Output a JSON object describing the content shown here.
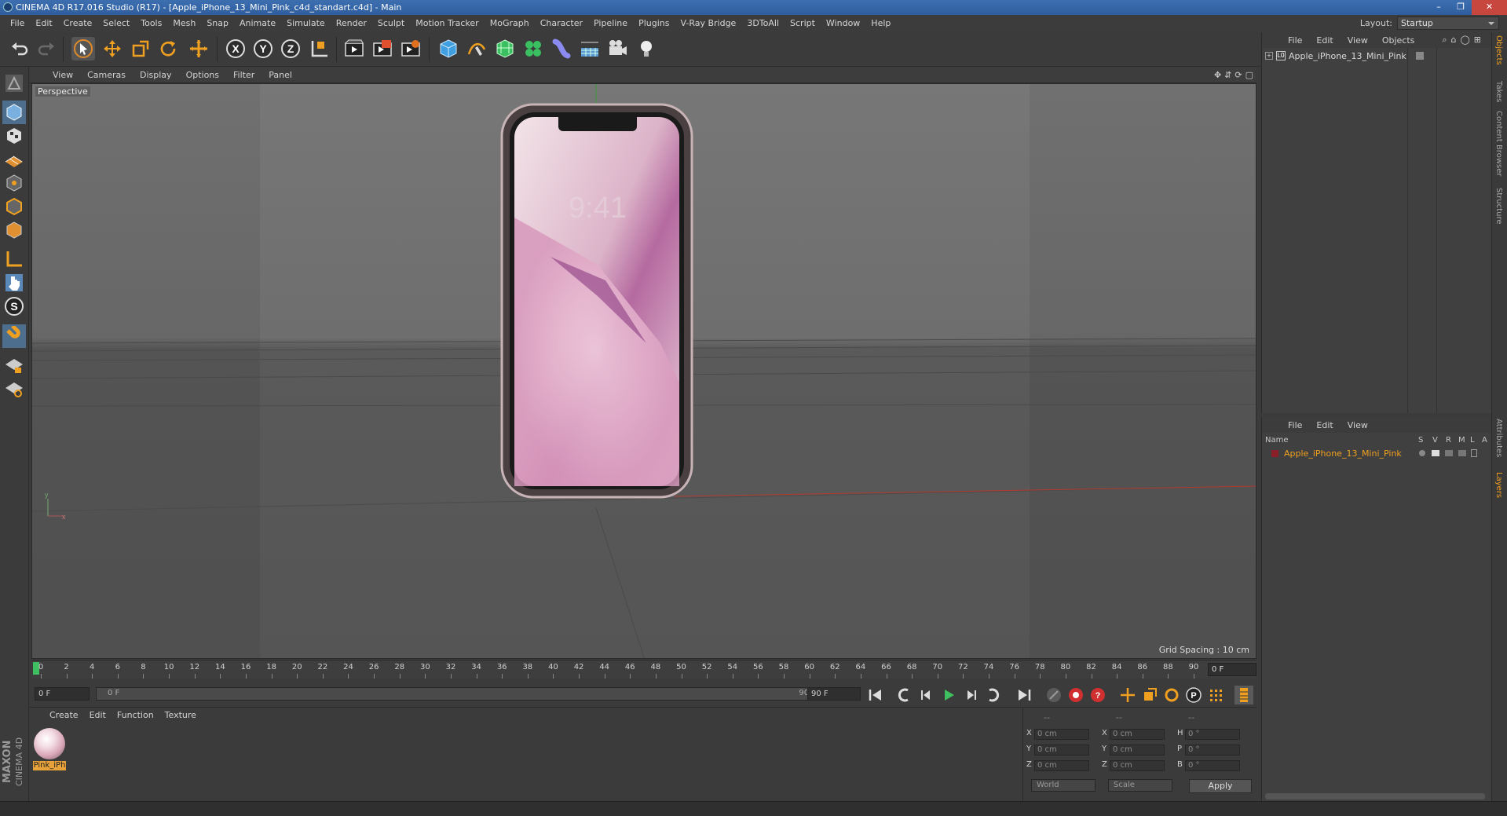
{
  "window": {
    "title": "CINEMA 4D R17.016 Studio (R17) - [Apple_iPhone_13_Mini_Pink_c4d_standart.c4d] - Main",
    "controls": [
      "–",
      "❐",
      "✕"
    ]
  },
  "menubar": {
    "items": [
      "File",
      "Edit",
      "Create",
      "Select",
      "Tools",
      "Mesh",
      "Snap",
      "Animate",
      "Simulate",
      "Render",
      "Sculpt",
      "Motion Tracker",
      "MoGraph",
      "Character",
      "Pipeline",
      "Plugins",
      "V-Ray Bridge",
      "3DToAll",
      "Script",
      "Window",
      "Help"
    ],
    "layout_label": "Layout:",
    "layout_value": "Startup"
  },
  "toolbar": {
    "icons": [
      "undo-icon",
      "redo-icon",
      "live-selection-icon",
      "move-icon",
      "scale-icon",
      "rotate-icon",
      "recent-tools-icon",
      "x-axis-icon",
      "y-axis-icon",
      "z-axis-icon",
      "coordinate-system-icon",
      "render-view-icon",
      "render-picture-viewer-icon",
      "edit-render-settings-icon",
      "cube-icon",
      "pen-spline-icon",
      "subdivision-icon",
      "cloner-icon",
      "deformer-icon",
      "floor-icon",
      "camera-icon",
      "light-icon"
    ],
    "axis_labels": [
      "X",
      "Y",
      "Z"
    ]
  },
  "lefttools": {
    "icons": [
      "make-editable-icon",
      "model-mode-icon",
      "texture-mode-icon",
      "workplane-icon",
      "points-mode-icon",
      "edges-mode-icon",
      "polygons-mode-icon",
      "axis-mode-icon",
      "tweak-icon",
      "snap-icon",
      "magnet-icon",
      "lock-workplane-icon",
      "solo-icon"
    ],
    "brand_line1": "MAXON",
    "brand_line2": "CINEMA 4D"
  },
  "viewport": {
    "menu": [
      "View",
      "Cameras",
      "Display",
      "Options",
      "Filter",
      "Panel"
    ],
    "label": "Perspective",
    "grid_spacing": "Grid Spacing : 10 cm",
    "nav_icons": "✥⇵⟳▢",
    "screen_time": "9:41",
    "axis_y": "y",
    "axis_x": "x"
  },
  "timeline": {
    "ticks": [
      "0",
      "2",
      "4",
      "6",
      "8",
      "10",
      "12",
      "14",
      "16",
      "18",
      "20",
      "22",
      "24",
      "26",
      "28",
      "30",
      "32",
      "34",
      "36",
      "38",
      "40",
      "42",
      "44",
      "46",
      "48",
      "50",
      "52",
      "54",
      "56",
      "58",
      "60",
      "62",
      "64",
      "66",
      "68",
      "70",
      "72",
      "74",
      "76",
      "78",
      "80",
      "82",
      "84",
      "86",
      "88",
      "90"
    ],
    "current_frame": "0 F"
  },
  "playbar": {
    "start": "0 F",
    "slider_start": "0 F",
    "slider_end": "90 F",
    "end": "90 F"
  },
  "material_manager": {
    "menu": [
      "Create",
      "Edit",
      "Function",
      "Texture"
    ],
    "material_name": "Pink_iPh"
  },
  "coordinates": {
    "header": [
      "--",
      "--",
      "--"
    ],
    "rows": [
      {
        "a": "X",
        "a_val": "0 cm",
        "b": "X",
        "b_val": "0 cm",
        "c": "H",
        "c_val": "0 °"
      },
      {
        "a": "Y",
        "a_val": "0 cm",
        "b": "Y",
        "b_val": "0 cm",
        "c": "P",
        "c_val": "0 °"
      },
      {
        "a": "Z",
        "a_val": "0 cm",
        "b": "Z",
        "b_val": "0 cm",
        "c": "B",
        "c_val": "0 °"
      }
    ],
    "world": "World",
    "scale": "Scale",
    "apply": "Apply"
  },
  "object_manager": {
    "menu": [
      "File",
      "Edit",
      "View",
      "Objects"
    ],
    "object_name": "Apple_iPhone_13_Mini_Pink"
  },
  "layer_manager": {
    "menu": [
      "File",
      "Edit",
      "View"
    ],
    "col_name": "Name",
    "cols": [
      "S",
      "V",
      "R",
      "M",
      "L",
      "A"
    ],
    "layer_name": "Apple_iPhone_13_Mini_Pink",
    "layer_color": "#8a1f2a"
  },
  "side_tabs": [
    "Objects",
    "Takes",
    "Content Browser",
    "Structure",
    "Attributes",
    "Layers"
  ],
  "colors": {
    "accent_orange": "#e8a23a",
    "title_blue": "#3d6fb0",
    "viewport_bg": "#6b6b6b"
  }
}
